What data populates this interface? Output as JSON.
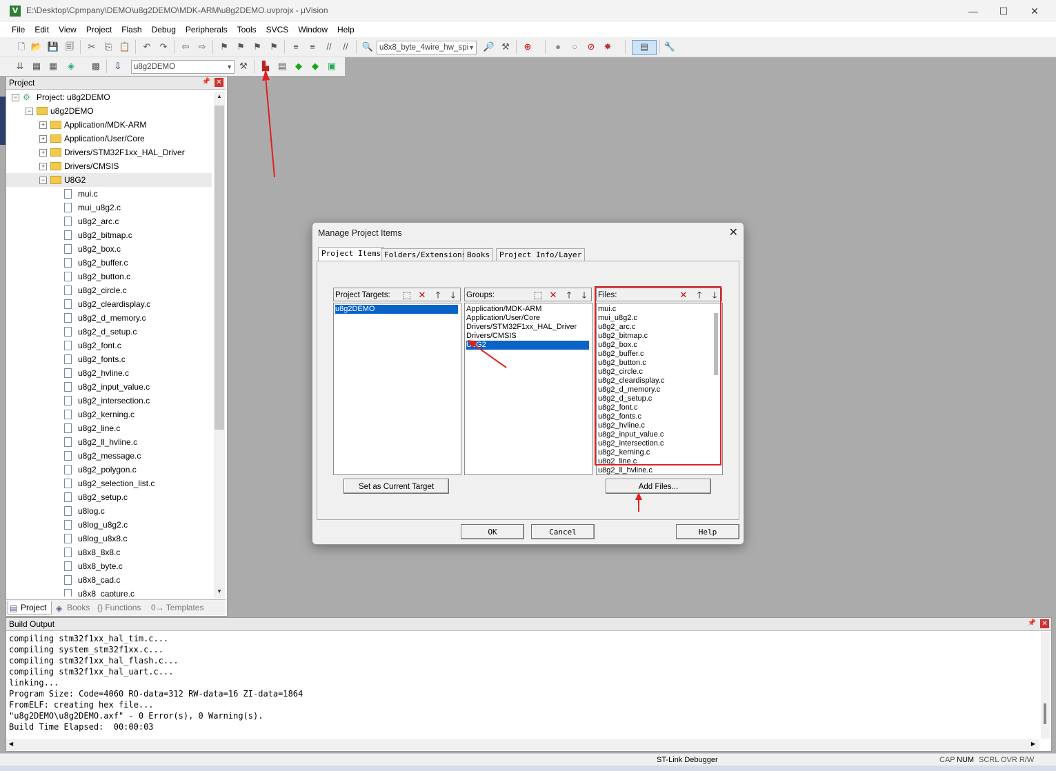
{
  "window": {
    "title": "E:\\Desktop\\Cpmpany\\DEMO\\u8g2DEMO\\MDK-ARM\\u8g2DEMO.uvprojx - µVision",
    "minimize": "—",
    "maximize": "☐",
    "close": "✕"
  },
  "menu": [
    "File",
    "Edit",
    "View",
    "Project",
    "Flash",
    "Debug",
    "Peripherals",
    "Tools",
    "SVCS",
    "Window",
    "Help"
  ],
  "toolbar": {
    "function_combo": "u8x8_byte_4wire_hw_spi",
    "target_combo": "u8g2DEMO"
  },
  "project_pane": {
    "title": "Project",
    "root": "Project: u8g2DEMO",
    "target": "u8g2DEMO",
    "groups": [
      "Application/MDK-ARM",
      "Application/User/Core",
      "Drivers/STM32F1xx_HAL_Driver",
      "Drivers/CMSIS",
      "U8G2"
    ],
    "files": [
      "mui.c",
      "mui_u8g2.c",
      "u8g2_arc.c",
      "u8g2_bitmap.c",
      "u8g2_box.c",
      "u8g2_buffer.c",
      "u8g2_button.c",
      "u8g2_circle.c",
      "u8g2_cleardisplay.c",
      "u8g2_d_memory.c",
      "u8g2_d_setup.c",
      "u8g2_font.c",
      "u8g2_fonts.c",
      "u8g2_hvline.c",
      "u8g2_input_value.c",
      "u8g2_intersection.c",
      "u8g2_kerning.c",
      "u8g2_line.c",
      "u8g2_ll_hvline.c",
      "u8g2_message.c",
      "u8g2_polygon.c",
      "u8g2_selection_list.c",
      "u8g2_setup.c",
      "u8log.c",
      "u8log_u8g2.c",
      "u8log_u8x8.c",
      "u8x8_8x8.c",
      "u8x8_byte.c",
      "u8x8_cad.c",
      "u8x8_capture.c"
    ],
    "tabs": [
      "Project",
      "Books",
      "{} Functions",
      "0→ Templates"
    ]
  },
  "dialog": {
    "title": "Manage Project Items",
    "tabs": [
      "Project Items",
      "Folders/Extensions",
      "Books",
      "Project Info/Layer"
    ],
    "targets_label": "Project Targets:",
    "targets": [
      "u8g2DEMO"
    ],
    "groups_label": "Groups:",
    "groups": [
      "Application/MDK-ARM",
      "Application/User/Core",
      "Drivers/STM32F1xx_HAL_Driver",
      "Drivers/CMSIS",
      "U8G2"
    ],
    "files_label": "Files:",
    "files": [
      "mui.c",
      "mui_u8g2.c",
      "u8g2_arc.c",
      "u8g2_bitmap.c",
      "u8g2_box.c",
      "u8g2_buffer.c",
      "u8g2_button.c",
      "u8g2_circle.c",
      "u8g2_cleardisplay.c",
      "u8g2_d_memory.c",
      "u8g2_d_setup.c",
      "u8g2_font.c",
      "u8g2_fonts.c",
      "u8g2_hvline.c",
      "u8g2_input_value.c",
      "u8g2_intersection.c",
      "u8g2_kerning.c",
      "u8g2_line.c",
      "u8g2_ll_hvline.c"
    ],
    "set_target_button": "Set as Current Target",
    "add_files_button": "Add Files...",
    "ok": "OK",
    "cancel": "Cancel",
    "help": "Help"
  },
  "build_output": {
    "title": "Build Output",
    "lines": [
      "compiling stm32f1xx_hal_tim.c...",
      "compiling system_stm32f1xx.c...",
      "compiling stm32f1xx_hal_flash.c...",
      "compiling stm32f1xx_hal_uart.c...",
      "linking...",
      "Program Size: Code=4060 RO-data=312 RW-data=16 ZI-data=1864",
      "FromELF: creating hex file...",
      "\"u8g2DEMO\\u8g2DEMO.axf\" - 0 Error(s), 0 Warning(s).",
      "Build Time Elapsed:  00:00:03"
    ]
  },
  "status": {
    "debugger": "ST-Link Debugger",
    "cap": "CAP",
    "num": "NUM",
    "scrl": "SCRL",
    "ovr": "OVR R/W"
  },
  "colors": {
    "selection": "#0a64c8",
    "annotation": "#e02020"
  }
}
